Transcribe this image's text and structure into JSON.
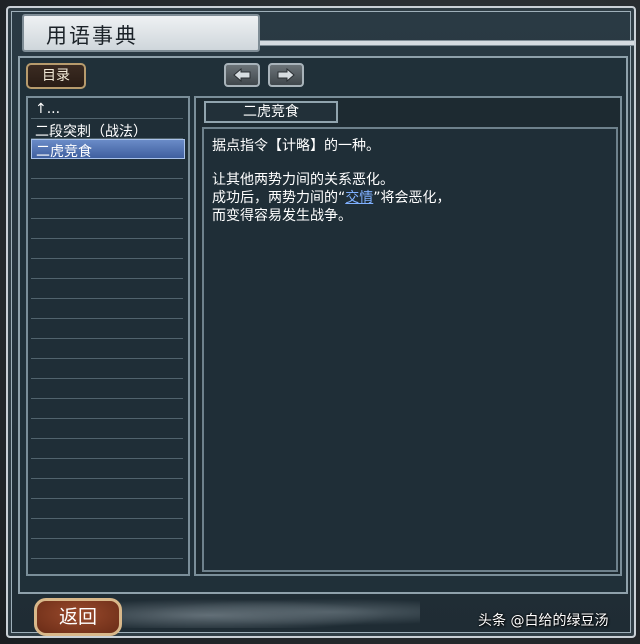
{
  "window": {
    "title": "用语事典"
  },
  "toolbar": {
    "contents_label": "目录",
    "back_icon": "arrow-left-icon",
    "forward_icon": "arrow-right-icon"
  },
  "list": {
    "items": [
      {
        "label": "↑..."
      },
      {
        "label": "二段突刺（战法）"
      },
      {
        "label": "二虎竞食",
        "selected": true
      }
    ]
  },
  "entry": {
    "term": "二虎竞食",
    "line1": "据点指令【计略】的一种。",
    "line2": "让其他两势力间的关系恶化。",
    "line3_pre": "成功后，两势力间的“",
    "line3_kw": "交情",
    "line3_post": "”将会恶化，",
    "line4": "而变得容易发生战争。"
  },
  "footer": {
    "back_label": "返回"
  },
  "watermark": "头条 @白给的绿豆汤",
  "colors": {
    "selected": "#4f6fb3",
    "keyword": "#7fb0ff",
    "back_button": "#7a3520"
  }
}
